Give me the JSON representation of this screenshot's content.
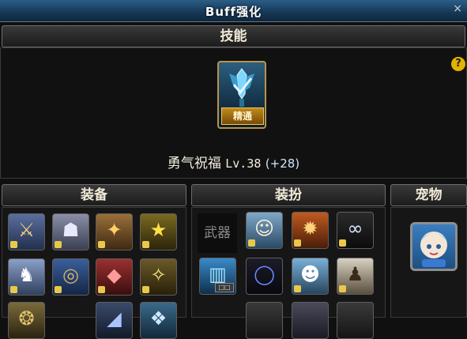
{
  "window": {
    "title": "Buff强化",
    "close_glyph": "×"
  },
  "skill_section": {
    "header": "技能",
    "help_glyph": "?",
    "skill": {
      "icon": "sword-crest-icon",
      "badge": "精通",
      "name": "勇气祝福",
      "level": "Lv.38",
      "bonus": "(+28)"
    }
  },
  "equip_section": {
    "header": "装备"
  },
  "avatar_section": {
    "header": "装扮",
    "weapon_label": "武器"
  },
  "pet_section": {
    "header": "宠物"
  },
  "colors": {
    "title_bar": "#173a5a",
    "gold_border": "#b8944a",
    "help_badge": "#e3b300"
  }
}
